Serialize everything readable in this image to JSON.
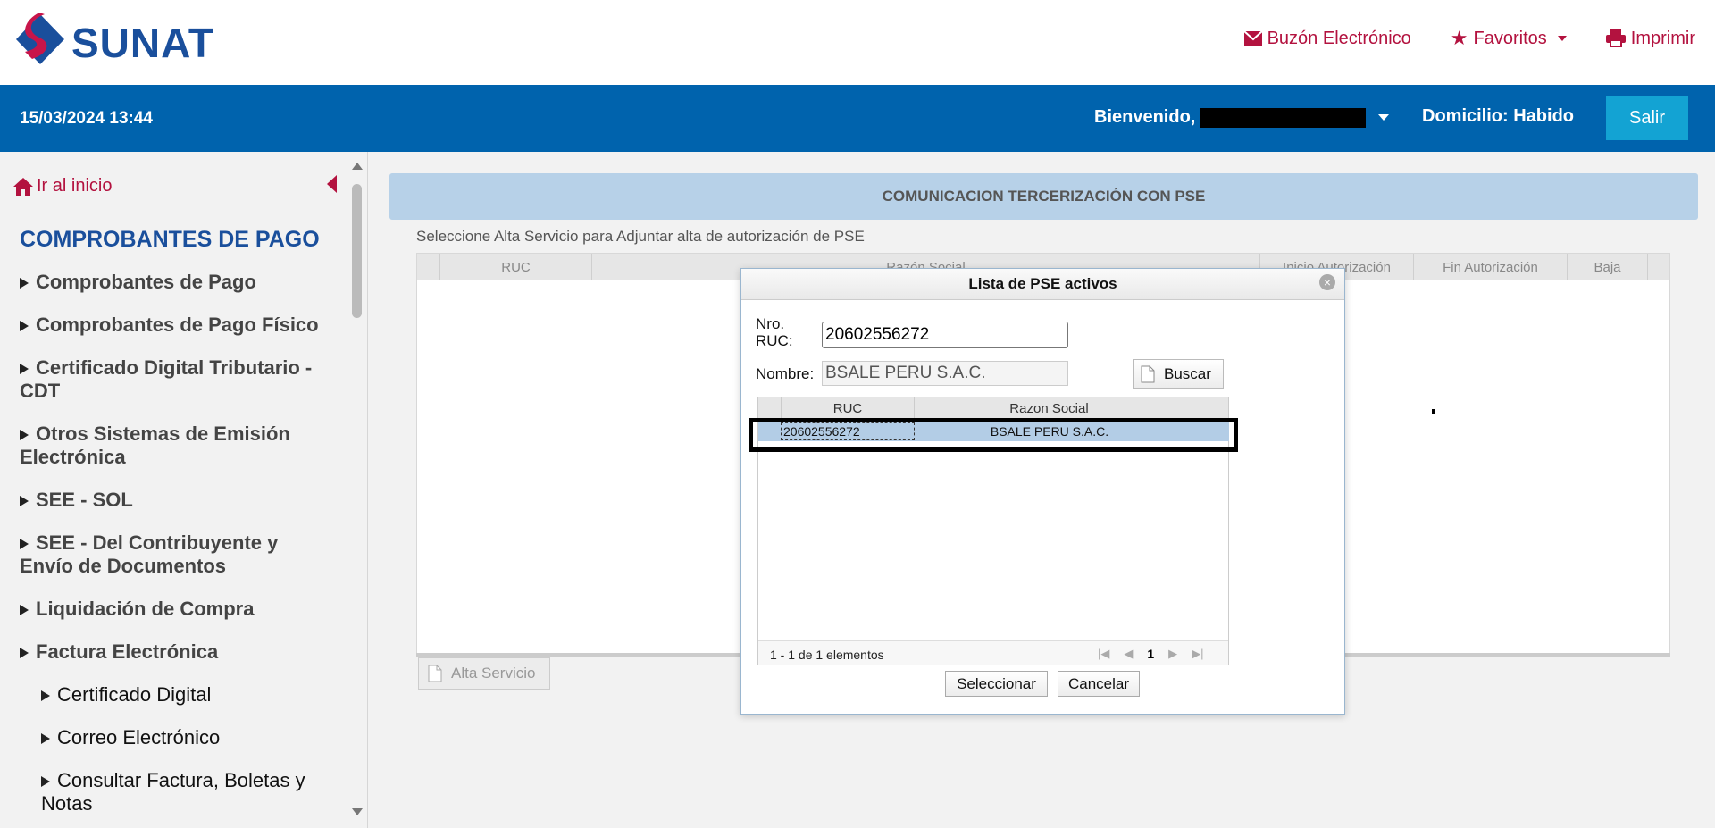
{
  "header": {
    "logo_text": "SUNAT",
    "links": {
      "buzon": "Buzón Electrónico",
      "favoritos": "Favoritos",
      "imprimir": "Imprimir"
    },
    "accent_color": "#b3123f"
  },
  "bluebar": {
    "datetime": "15/03/2024 13:44",
    "welcome": "Bienvenido,",
    "domicilio": "Domicilio: Habido",
    "salir": "Salir",
    "color": "#0063ad"
  },
  "sidebar": {
    "ir_inicio": "Ir al inicio",
    "title": "COMPROBANTES DE PAGO",
    "items": [
      {
        "label": "Comprobantes de Pago",
        "sub": false
      },
      {
        "label": "Comprobantes de Pago Físico",
        "sub": false
      },
      {
        "label": "Certificado Digital Tributario - CDT",
        "sub": false
      },
      {
        "label": "Otros Sistemas de Emisión Electrónica",
        "sub": false
      },
      {
        "label": "SEE - SOL",
        "sub": false
      },
      {
        "label": "SEE - Del Contribuyente y Envío de Documentos",
        "sub": false
      },
      {
        "label": "Liquidación de Compra",
        "sub": false
      },
      {
        "label": "Factura Electrónica",
        "sub": false
      },
      {
        "label": "Certificado Digital",
        "sub": true
      },
      {
        "label": "Correo Electrónico",
        "sub": true
      },
      {
        "label": "Consultar Factura, Boletas y Notas",
        "sub": true
      }
    ]
  },
  "main": {
    "panel_title": "COMUNICACION TERCERIZACIÓN CON PSE",
    "instruction": "Seleccione Alta Servicio para Adjuntar alta de autorización de PSE",
    "columns": [
      "RUC",
      "Razón Social",
      "Inicio Autorización",
      "Fin Autorización",
      "Baja"
    ],
    "alta_button": "Alta Servicio"
  },
  "modal": {
    "title": "Lista de PSE activos",
    "ruc_label": "Nro. RUC:",
    "ruc_value": "20602556272",
    "nombre_label": "Nombre:",
    "nombre_value": "BSALE PERU S.A.C.",
    "buscar": "Buscar",
    "columns": [
      "RUC",
      "Razon Social"
    ],
    "rows": [
      {
        "ruc": "20602556272",
        "razon": "BSALE PERU S.A.C."
      }
    ],
    "pager_info": "1 - 1 de 1 elementos",
    "current_page": "1",
    "seleccionar": "Seleccionar",
    "cancelar": "Cancelar"
  }
}
